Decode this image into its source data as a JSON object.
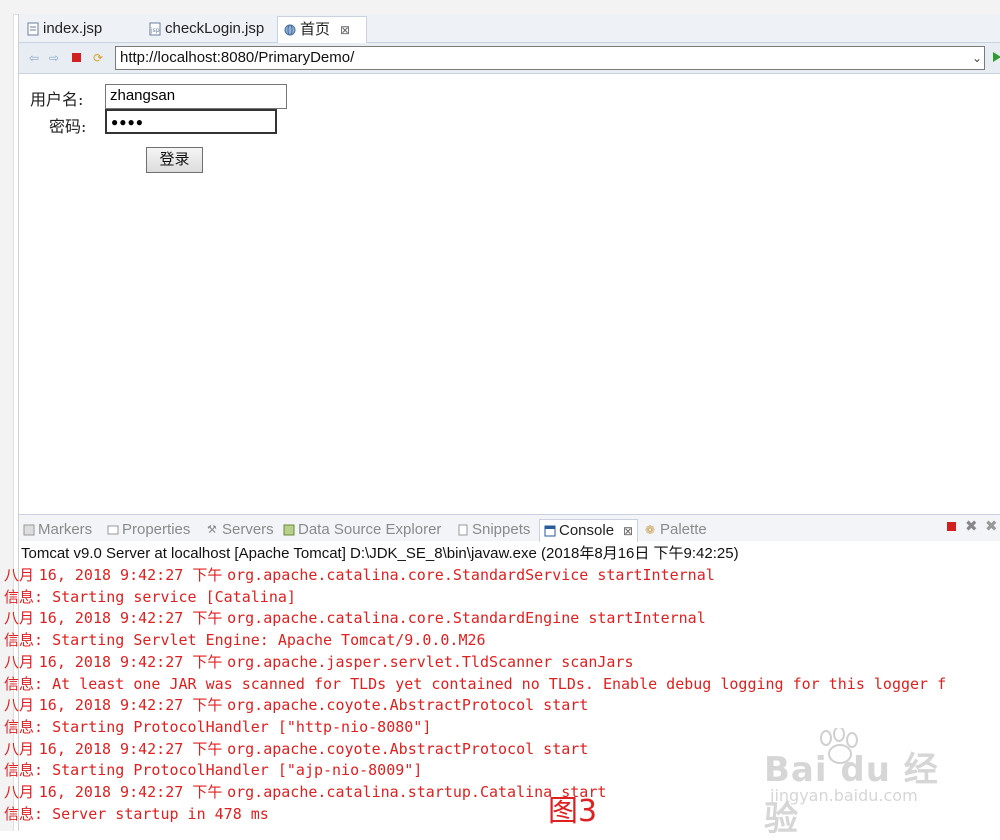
{
  "editor_tabs": [
    {
      "label": "index.jsp",
      "icon": "jsp-file-icon"
    },
    {
      "label": "checkLogin.jsp",
      "icon": "jsp-file-icon"
    },
    {
      "label": "首页",
      "icon": "globe-icon",
      "active": true
    }
  ],
  "browser": {
    "url": "http://localhost:8080/PrimaryDemo/"
  },
  "form": {
    "username_label": "用户名:",
    "username_value": "zhangsan",
    "password_label": "密码:",
    "password_mask": "●●●●",
    "login_label": "登录"
  },
  "view_tabs": [
    {
      "label": "Markers"
    },
    {
      "label": "Properties"
    },
    {
      "label": "Servers"
    },
    {
      "label": "Data Source Explorer"
    },
    {
      "label": "Snippets"
    },
    {
      "label": "Console",
      "active": true
    },
    {
      "label": "Palette"
    }
  ],
  "console": {
    "title": "Tomcat v9.0 Server at localhost [Apache Tomcat] D:\\JDK_SE_8\\bin\\javaw.exe (2018年8月16日 下午9:42:25)",
    "lines": [
      {
        "prefix": "八月 ",
        "text": "16, 2018 9:42:27 ",
        "suffix": "下午 ",
        "rest": "org.apache.catalina.core.StandardService startInternal"
      },
      {
        "prefix": "信息",
        "text": ": Starting service [Catalina]"
      },
      {
        "prefix": "八月 ",
        "text": "16, 2018 9:42:27 ",
        "suffix": "下午 ",
        "rest": "org.apache.catalina.core.StandardEngine startInternal"
      },
      {
        "prefix": "信息",
        "text": ": Starting Servlet Engine: Apache Tomcat/9.0.0.M26"
      },
      {
        "prefix": "八月 ",
        "text": "16, 2018 9:42:27 ",
        "suffix": "下午 ",
        "rest": "org.apache.jasper.servlet.TldScanner scanJars"
      },
      {
        "prefix": "信息",
        "text": ": At least one JAR was scanned for TLDs yet contained no TLDs. Enable debug logging for this logger f"
      },
      {
        "prefix": "八月 ",
        "text": "16, 2018 9:42:27 ",
        "suffix": "下午 ",
        "rest": "org.apache.coyote.AbstractProtocol start"
      },
      {
        "prefix": "信息",
        "text": ": Starting ProtocolHandler [\"http-nio-8080\"]"
      },
      {
        "prefix": "八月 ",
        "text": "16, 2018 9:42:27 ",
        "suffix": "下午 ",
        "rest": "org.apache.coyote.AbstractProtocol start"
      },
      {
        "prefix": "信息",
        "text": ": Starting ProtocolHandler [\"ajp-nio-8009\"]"
      },
      {
        "prefix": "八月 ",
        "text": "16, 2018 9:42:27 ",
        "suffix": "下午 ",
        "rest": "org.apache.catalina.startup.Catalina start"
      },
      {
        "prefix": "信息",
        "text": ": Server startup in 478 ms"
      }
    ]
  },
  "overlay": {
    "figure_label": "图3",
    "watermark_brand": "Bai du 经验",
    "watermark_url": "jingyan.baidu.com"
  },
  "colors": {
    "console_text": "#e02020",
    "tab_bg": "#eef1f6",
    "accent_green": "#2e9c2e"
  }
}
